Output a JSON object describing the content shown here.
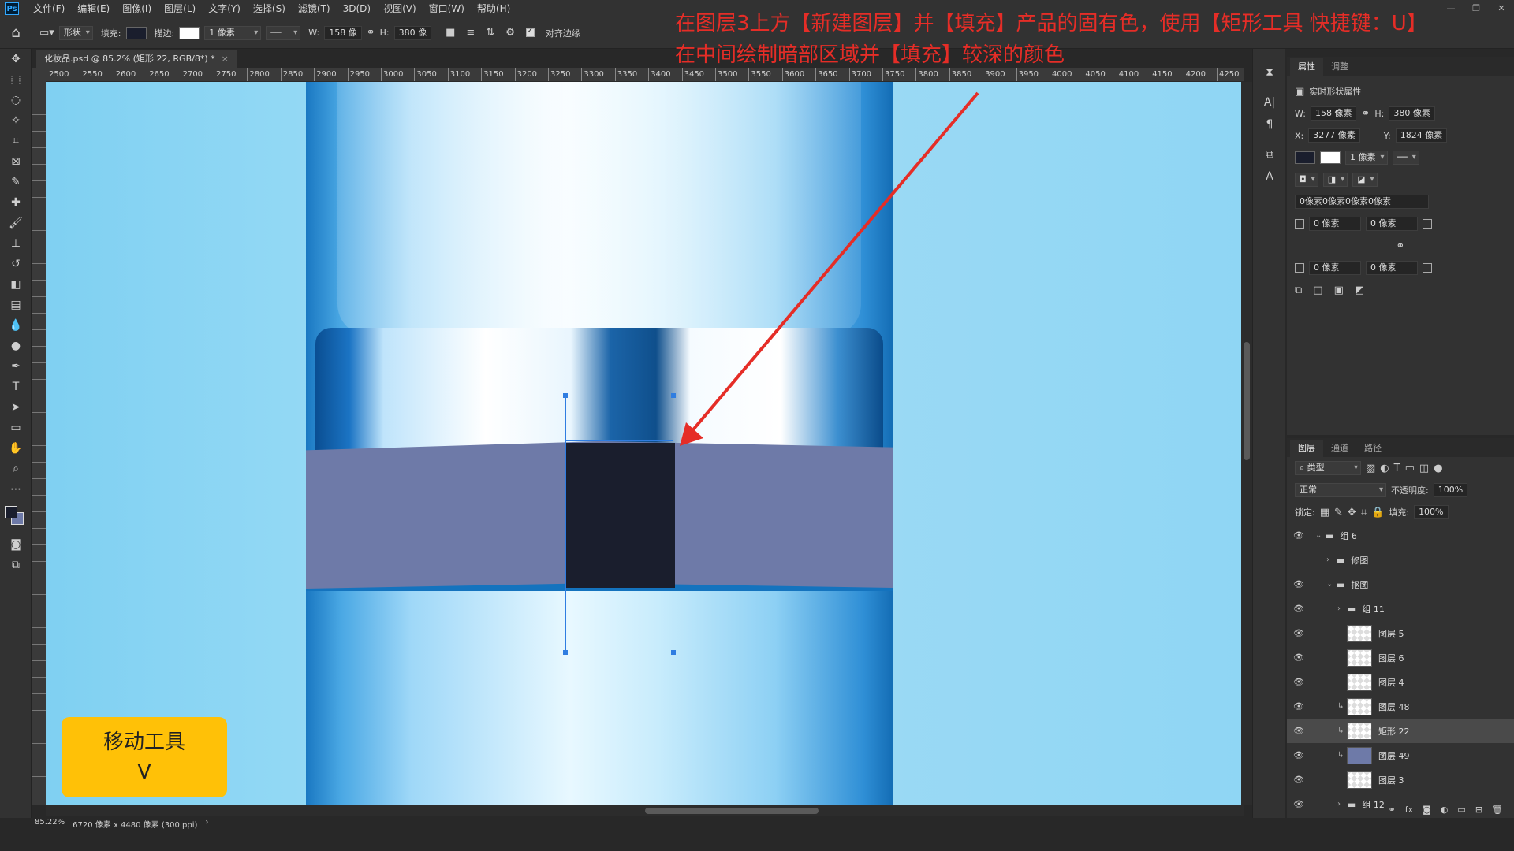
{
  "menu": {
    "app_logo": "Ps",
    "items": [
      "文件(F)",
      "编辑(E)",
      "图像(I)",
      "图层(L)",
      "文字(Y)",
      "选择(S)",
      "滤镜(T)",
      "3D(D)",
      "视图(V)",
      "窗口(W)",
      "帮助(H)"
    ]
  },
  "options": {
    "mode": "形状",
    "fill_label": "填充:",
    "stroke_label": "描边:",
    "stroke_width": "1 像素",
    "w_label": "W:",
    "w_value": "158 像",
    "h_label": "H:",
    "h_value": "380 像",
    "align_edges": "对齐边缘"
  },
  "document": {
    "tab_title": "化妆品.psd @ 85.2% (矩形 22, RGB/8*) *",
    "ruler_ticks": [
      "2500",
      "2550",
      "2600",
      "2650",
      "2700",
      "2750",
      "2800",
      "2850",
      "2900",
      "2950",
      "3000",
      "3050",
      "3100",
      "3150",
      "3200",
      "3250",
      "3300",
      "3350",
      "3400",
      "3450",
      "3500",
      "3550",
      "3600",
      "3650",
      "3700",
      "3750",
      "3800",
      "3850",
      "3900",
      "3950",
      "4000",
      "4050",
      "4100",
      "4150",
      "4200",
      "4250"
    ],
    "zoom": "85.22%",
    "doc_info": "6720 像素 x 4480 像素 (300 ppi)"
  },
  "annotation": {
    "line1": "在图层3上方【新建图层】并【填充】产品的固有色，使用【矩形工具 快捷键：U】",
    "line2": "在中间绘制暗部区域并【填充】较深的颜色"
  },
  "hint": {
    "title": "移动工具",
    "key": "V"
  },
  "properties": {
    "tabs": [
      "属性",
      "调整"
    ],
    "header": "实时形状属性",
    "w_label": "W:",
    "w_value": "158 像素",
    "h_label": "H:",
    "h_value": "380 像素",
    "x_label": "X:",
    "x_value": "3277 像素",
    "y_label": "Y:",
    "y_value": "1824 像素",
    "stroke_width": "1 像素",
    "radius_summary": "0像素0像素0像素0像素",
    "corner_tl": "0 像素",
    "corner_tr": "0 像素",
    "corner_bl": "0 像素",
    "corner_br": "0 像素"
  },
  "layers_panel": {
    "tabs": [
      "图层",
      "通道",
      "路径"
    ],
    "filter": "类型",
    "blend_mode": "正常",
    "opacity_label": "不透明度:",
    "opacity": "100%",
    "lock_label": "锁定:",
    "fill_label": "填充:",
    "fill": "100%",
    "layers": [
      {
        "name": "组 6",
        "kind": "folder",
        "visible": true
      },
      {
        "name": "修图",
        "kind": "folder",
        "visible": false
      },
      {
        "name": "抠图",
        "kind": "folder",
        "visible": true
      },
      {
        "name": "组 11",
        "kind": "folder",
        "visible": true
      },
      {
        "name": "图层 5",
        "kind": "layer",
        "visible": true
      },
      {
        "name": "图层 6",
        "kind": "layer",
        "visible": true
      },
      {
        "name": "图层 4",
        "kind": "layer",
        "visible": true
      },
      {
        "name": "图层 48",
        "kind": "layer",
        "visible": true
      },
      {
        "name": "矩形 22",
        "kind": "shape",
        "visible": true,
        "active": true
      },
      {
        "name": "图层 49",
        "kind": "layer-blue",
        "visible": true
      },
      {
        "name": "图层 3",
        "kind": "layer",
        "visible": true
      },
      {
        "name": "组 12",
        "kind": "folder",
        "visible": true
      }
    ]
  },
  "colors": {
    "foreground": "#1a1e2d",
    "background": "#6e7aa8",
    "annotation": "#e52d27",
    "hint_bg": "#ffc107",
    "selection": "#2f7de1"
  }
}
